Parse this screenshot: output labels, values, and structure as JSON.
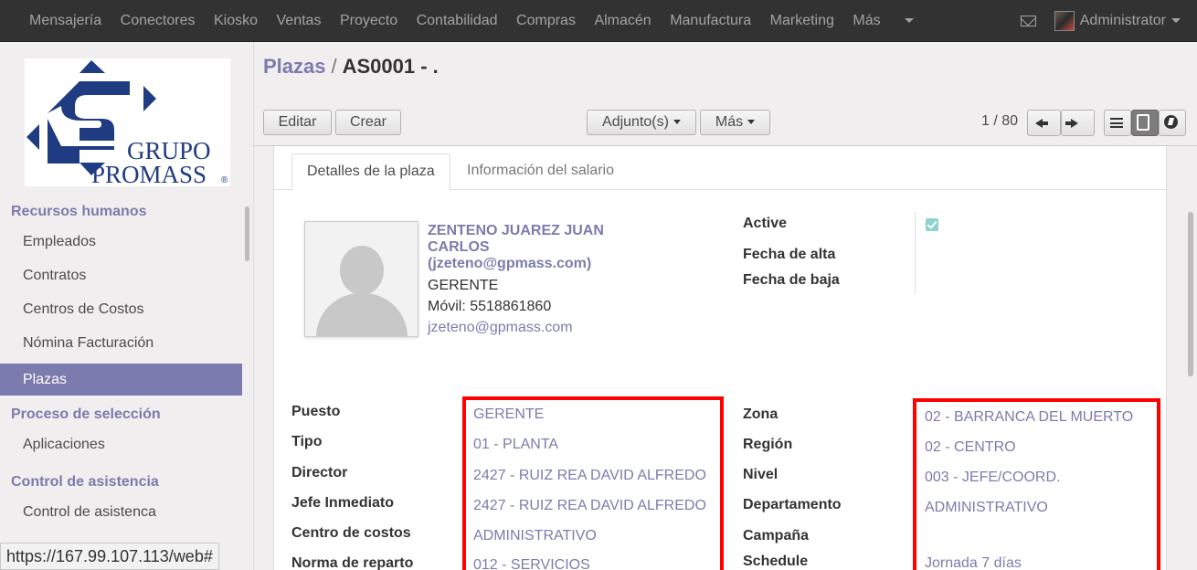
{
  "topbar": {
    "menu": [
      "Mensajería",
      "Conectores",
      "Kiosko",
      "Ventas",
      "Proyecto",
      "Contabilidad",
      "Compras",
      "Almacén",
      "Manufactura",
      "Marketing",
      "Más"
    ],
    "user": "Administrator"
  },
  "logo": {
    "line1": "GRUPO",
    "line2": "PROMASS",
    "mark": "®",
    "color": "#1f3b82"
  },
  "sidebar": {
    "sections": [
      {
        "title": "Recursos humanos",
        "items": [
          "Empleados",
          "Contratos",
          "Centros de Costos",
          "Nómina Facturación",
          "Plazas"
        ]
      },
      {
        "title": "Proceso de selección",
        "items": [
          "Aplicaciones"
        ]
      },
      {
        "title": "Control de asistencia",
        "items": [
          "Control de asistenca"
        ]
      }
    ],
    "active_item": "Plazas"
  },
  "breadcrumb": {
    "parent": "Plazas",
    "separator": "/",
    "current": "AS0001 - ."
  },
  "buttons": {
    "edit": "Editar",
    "create": "Crear",
    "attachments": "Adjunto(s)",
    "more": "Más"
  },
  "pager": {
    "text": "1 / 80"
  },
  "tabs": [
    "Detalles de la plaza",
    "Información del salario"
  ],
  "employee": {
    "name": "ZENTENO JUAREZ JUAN CARLOS (jzeteno@gpmass.com)",
    "job": "GERENTE",
    "mobile": "Móvil: 5518861860",
    "email": "jzeteno@gpmass.com"
  },
  "status_fields": {
    "active_label": "Active",
    "active_checked": true,
    "alta_label": "Fecha de alta",
    "baja_label": "Fecha de baja"
  },
  "left_fields": [
    {
      "label": "Puesto",
      "value": "GERENTE"
    },
    {
      "label": "Tipo",
      "value": "01 - PLANTA"
    },
    {
      "label": "Director",
      "value": "2427 - RUIZ REA DAVID ALFREDO"
    },
    {
      "label": "Jefe Inmediato",
      "value": "2427 - RUIZ REA DAVID ALFREDO"
    },
    {
      "label": "Centro de costos",
      "value": "ADMINISTRATIVO"
    },
    {
      "label": "Norma de reparto",
      "value": "012 - SERVICIOS"
    }
  ],
  "right_fields": [
    {
      "label": "Zona",
      "value": "02 - BARRANCA DEL MUERTO"
    },
    {
      "label": "Región",
      "value": "02 - CENTRO"
    },
    {
      "label": "Nivel",
      "value": "003 - JEFE/COORD."
    },
    {
      "label": "Departamento",
      "value": "ADMINISTRATIVO"
    },
    {
      "label": "Campaña",
      "value": ""
    },
    {
      "label": "Schedule",
      "value": "Jornada 7 días"
    }
  ],
  "status_bar": {
    "url": "https://167.99.107.113/web#"
  },
  "colors": {
    "accent": "#7c7bad",
    "topbar": "#323232",
    "highlight": "#ff0000"
  }
}
